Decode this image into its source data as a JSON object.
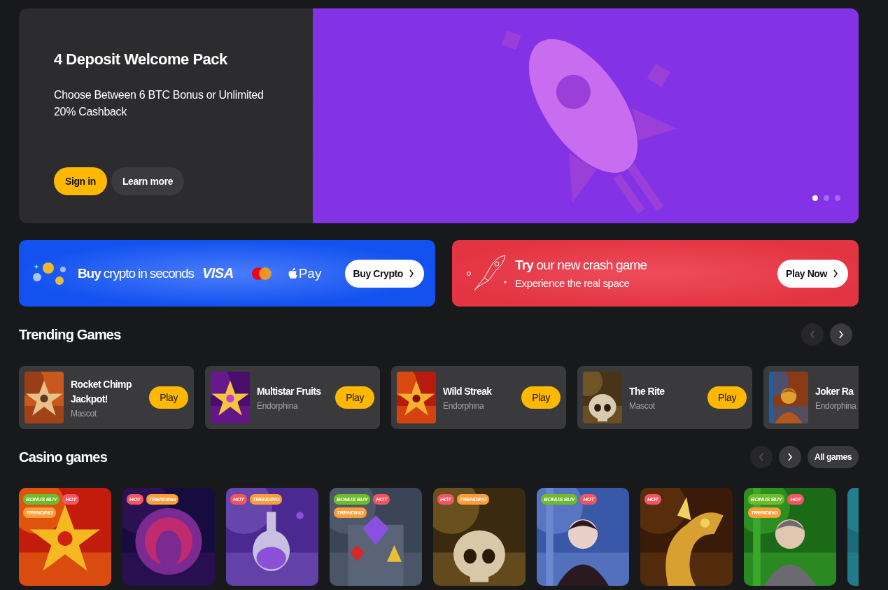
{
  "hero": {
    "title": "4 Deposit Welcome Pack",
    "subtitle": "Choose Between 6 BTC Bonus or Unlimited 20% Cashback",
    "buttons": [
      {
        "label": "Sign in",
        "kind": "primary"
      },
      {
        "label": "Learn more",
        "kind": "secondary"
      }
    ],
    "slides": [
      {
        "selected": true
      },
      {
        "selected": false
      },
      {
        "selected": false
      }
    ]
  },
  "crypto_banner": {
    "headline": "**Buy** crypto in seconds",
    "visa": "VISA",
    "apple_pay": "Pay",
    "button": "Buy Crypto"
  },
  "crash_banner": {
    "headline": "**Try** our new crash game",
    "subline": "Experience the real space",
    "button": "Play Now"
  },
  "trending": {
    "title": "Trending Games",
    "nav": [
      {
        "kind": "prev",
        "disabled": true
      },
      {
        "kind": "next",
        "disabled": false
      }
    ],
    "games": [
      {
        "title": "Rocket Chimp Jackpot!",
        "provider": "Mascot",
        "button": "Play"
      },
      {
        "title": "Multistar Fruits",
        "provider": "Endorphina",
        "button": "Play"
      },
      {
        "title": "Wild Streak",
        "provider": "Endorphina",
        "button": "Play"
      },
      {
        "title": "The Rite",
        "provider": "Mascot",
        "button": "Play"
      },
      {
        "title": "Joker Ra",
        "provider": "Endorphina"
      }
    ]
  },
  "casino": {
    "title": "Casino games",
    "nav": [
      {
        "kind": "prev",
        "disabled": true
      },
      {
        "kind": "next",
        "disabled": false
      }
    ],
    "all_button": "All games",
    "tiles": [
      {
        "tags": [
          {
            "label": "BONUS BUY",
            "kind": "bonus"
          },
          {
            "label": "HOT",
            "kind": "hot"
          },
          {
            "label": "TRENDING",
            "kind": "trending"
          }
        ]
      },
      {
        "tags": [
          {
            "label": "HOT",
            "kind": "hot"
          },
          {
            "label": "TRENDING",
            "kind": "trending"
          }
        ]
      },
      {
        "tags": [
          {
            "label": "HOT",
            "kind": "hot"
          },
          {
            "label": "TRENDING",
            "kind": "trending"
          }
        ]
      },
      {
        "tags": [
          {
            "label": "BONUS BUY",
            "kind": "bonus"
          },
          {
            "label": "HOT",
            "kind": "hot"
          },
          {
            "label": "TRENDING",
            "kind": "trending"
          }
        ]
      },
      {
        "tags": [
          {
            "label": "HOT",
            "kind": "hot"
          },
          {
            "label": "TRENDING",
            "kind": "trending"
          }
        ]
      },
      {
        "tags": [
          {
            "label": "BONUS BUY",
            "kind": "bonus"
          },
          {
            "label": "HOT",
            "kind": "hot"
          }
        ]
      },
      {
        "tags": [
          {
            "label": "HOT",
            "kind": "hot"
          }
        ]
      },
      {
        "tags": [
          {
            "label": "BONUS BUY",
            "kind": "bonus"
          },
          {
            "label": "HOT",
            "kind": "hot"
          },
          {
            "label": "TRENDING",
            "kind": "trending"
          }
        ]
      },
      {
        "kind": "picture"
      }
    ]
  }
}
